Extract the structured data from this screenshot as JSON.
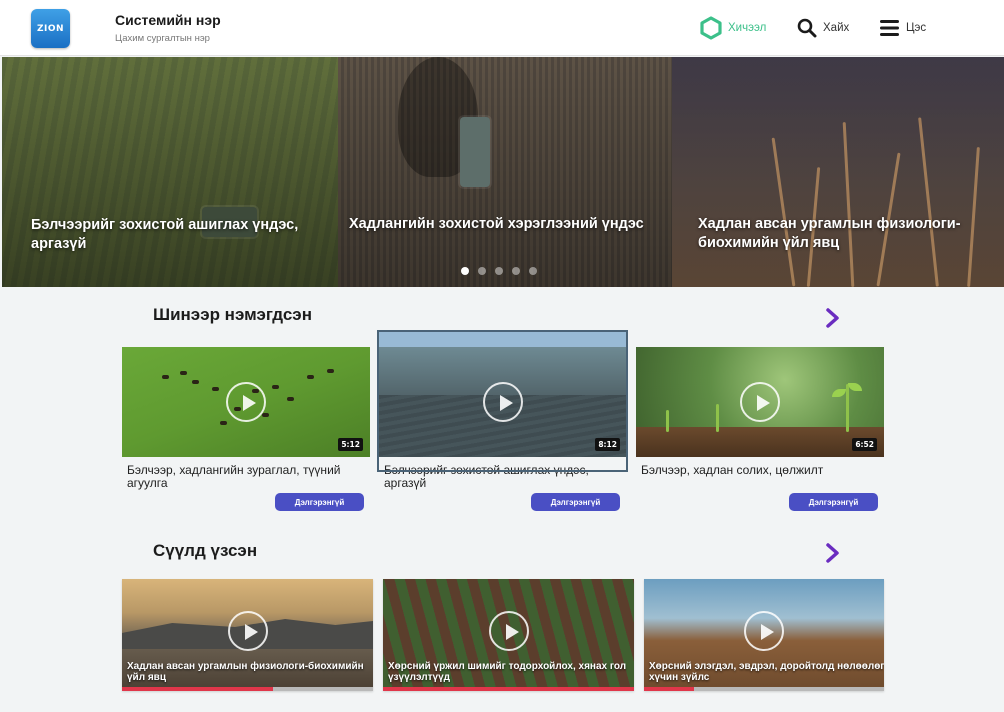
{
  "header": {
    "logo_text": "ZION",
    "system_name": "Системийн нэр",
    "system_subtitle": "Цахим сургалтын нэр",
    "nav": {
      "lessons": "Хичээл",
      "search": "Хайх",
      "menu": "Цэс"
    },
    "colors": {
      "lessons_accent": "#3cc08a",
      "logo": "#1a6fc4"
    }
  },
  "hero": {
    "slides": [
      {
        "caption": "Бэлчээрийг зохистой ашиглах үндэс, аргазүй"
      },
      {
        "caption": "Хадлангийн зохистой хэрэглээний үндэс"
      },
      {
        "caption": "Хадлан авсан ургамлын физиологи-биохимийн үйл явц"
      }
    ],
    "dots": 5,
    "active_dot": 0
  },
  "new_section": {
    "title": "Шинээр нэмэгдсэн",
    "more_icon": "chevron-right-icon",
    "cards": [
      {
        "title": "Бэлчээр, хадлангийн зураглал, түүний агуулга",
        "duration": "5:12",
        "button": "Дэлгэрэнгүй"
      },
      {
        "title": "Бэлчээрийг зохистой ашиглах үндэс, аргазүй",
        "duration": "8:12",
        "button": "Дэлгэрэнгүй"
      },
      {
        "title": "Бэлчээр, хадлан солих, цөлжилт",
        "duration": "6:52",
        "button": "Дэлгэрэнгүй"
      }
    ]
  },
  "recent_section": {
    "title": "Сүүлд үзсэн",
    "more_icon": "chevron-right-icon",
    "items": [
      {
        "title": "Хадлан авсан ургамлын физиологи-биохимийн үйл явц",
        "progress": 0.6
      },
      {
        "title": "Хөрсний үржил шимийг тодорхойлох, хянах гол үзүүлэлтүүд",
        "progress": 1.0
      },
      {
        "title": "Хөрсний элэгдэл, эвдрэл, доройтолд нөлөөлөг хүчин зүйлс",
        "progress": 0.21
      }
    ]
  },
  "colors": {
    "button": "#4a4fc4",
    "chevron": "#6a2cc0",
    "progress": "#e0364a"
  }
}
